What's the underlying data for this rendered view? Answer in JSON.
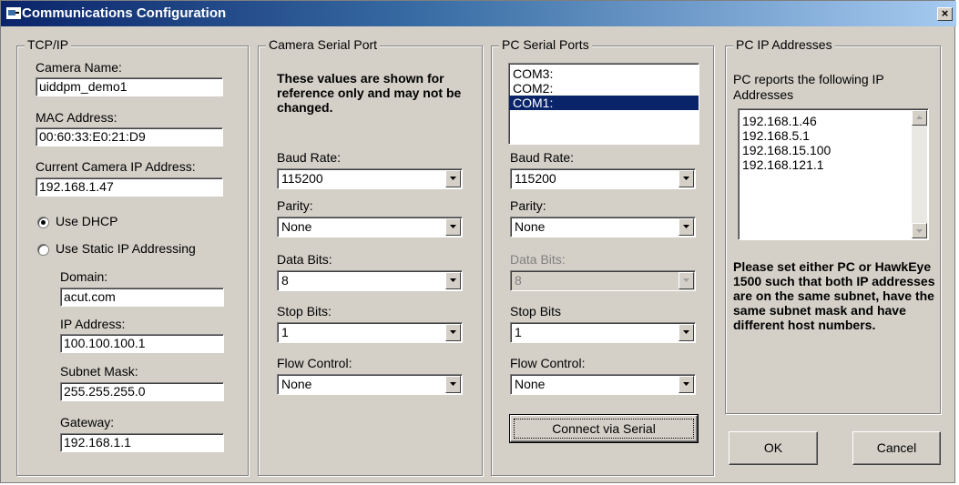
{
  "window": {
    "title": "Communications Configuration",
    "close_glyph": "×"
  },
  "tcpip": {
    "legend": "TCP/IP",
    "camera_name_label": "Camera Name:",
    "camera_name_value": "uiddpm_demo1",
    "mac_label": "MAC Address:",
    "mac_value": "00:60:33:E0:21:D9",
    "current_ip_label": "Current Camera IP Address:",
    "current_ip_value": "192.168.1.47",
    "dhcp_label": "Use DHCP",
    "static_label": "Use Static IP Addressing",
    "selected_mode": "dhcp",
    "domain_label": "Domain:",
    "domain_value": "acut.com",
    "ip_label": "IP Address:",
    "ip_value": "100.100.100.1",
    "subnet_label": "Subnet Mask:",
    "subnet_value": "255.255.255.0",
    "gateway_label": "Gateway:",
    "gateway_value": "192.168.1.1"
  },
  "camera_serial": {
    "legend": "Camera Serial Port",
    "note": "These values are shown for reference only and may not be changed.",
    "baud_label": "Baud Rate:",
    "baud_value": "115200",
    "parity_label": "Parity:",
    "parity_value": "None",
    "databits_label": "Data Bits:",
    "databits_value": "8",
    "stopbits_label": "Stop Bits:",
    "stopbits_value": "1",
    "flow_label": "Flow Control:",
    "flow_value": "None"
  },
  "pc_serial": {
    "legend": "PC Serial Ports",
    "ports": [
      "COM3:",
      "COM2:",
      "COM1:"
    ],
    "selected_port": "COM1:",
    "baud_label": "Baud Rate:",
    "baud_value": "115200",
    "parity_label": "Parity:",
    "parity_value": "None",
    "databits_label": "Data Bits:",
    "databits_value": "8",
    "stopbits_label": "Stop Bits",
    "stopbits_value": "1",
    "flow_label": "Flow Control:",
    "flow_value": "None",
    "connect_label": "Connect via Serial"
  },
  "pc_ip": {
    "legend": "PC IP Addresses",
    "intro": "PC reports the following IP Addresses",
    "addresses": [
      "192.168.1.46",
      "192.168.5.1",
      "192.168.15.100",
      "192.168.121.1"
    ],
    "warning": "Please set either PC or HawkEye 1500 such that both IP addresses are on the same subnet, have the same subnet mask and have different host numbers."
  },
  "buttons": {
    "ok": "OK",
    "cancel": "Cancel"
  }
}
